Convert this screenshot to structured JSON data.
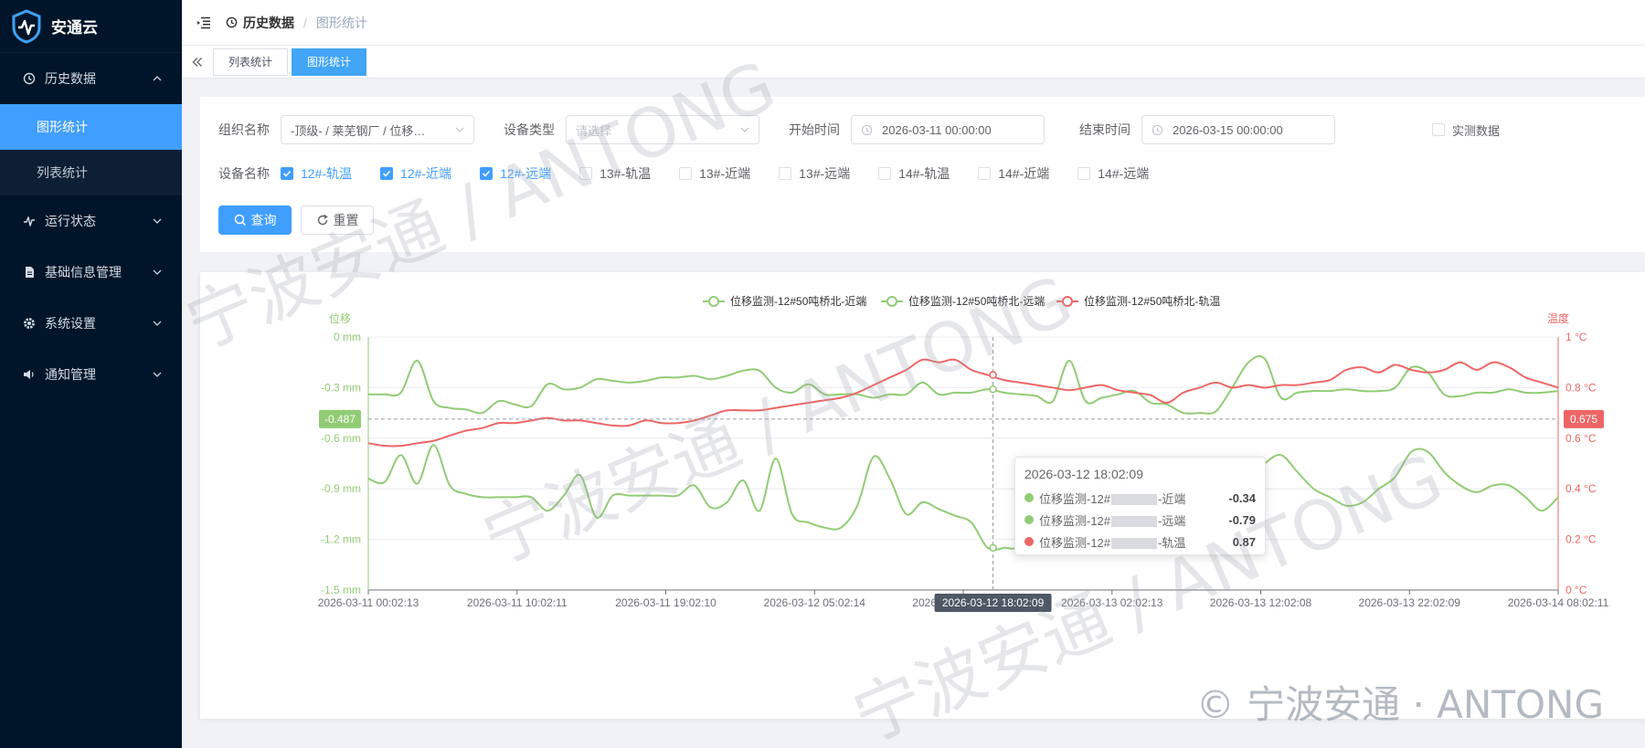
{
  "app": {
    "name": "安通云"
  },
  "sidebar": {
    "items": [
      {
        "label": "历史数据",
        "icon": "history-icon",
        "expanded": true,
        "children": [
          {
            "label": "图形统计",
            "active": true
          },
          {
            "label": "列表统计",
            "active": false
          }
        ]
      },
      {
        "label": "运行状态",
        "icon": "pulse-icon"
      },
      {
        "label": "基础信息管理",
        "icon": "document-icon"
      },
      {
        "label": "系统设置",
        "icon": "gear-icon"
      },
      {
        "label": "通知管理",
        "icon": "speaker-icon"
      }
    ]
  },
  "header": {
    "breadcrumb": [
      "历史数据",
      "图形统计"
    ],
    "separator": "/"
  },
  "tabs": [
    {
      "label": "列表统计",
      "active": false
    },
    {
      "label": "图形统计",
      "active": true
    }
  ],
  "filters": {
    "org_label": "组织名称",
    "org_value": "-顶级- / 莱芜钢厂 / 位移…",
    "type_label": "设备类型",
    "type_placeholder": "请选择",
    "start_label": "开始时间",
    "start_value": "2026-03-11 00:00:00",
    "end_label": "结束时间",
    "end_value": "2026-03-15 00:00:00",
    "realtime_label": "实测数据",
    "device_label": "设备名称",
    "devices": [
      {
        "label": "12#-轨温",
        "checked": true
      },
      {
        "label": "12#-近端",
        "checked": true
      },
      {
        "label": "12#-远端",
        "checked": true
      },
      {
        "label": "13#-轨温",
        "checked": false
      },
      {
        "label": "13#-近端",
        "checked": false
      },
      {
        "label": "13#-远端",
        "checked": false
      },
      {
        "label": "14#-轨温",
        "checked": false
      },
      {
        "label": "14#-近端",
        "checked": false
      },
      {
        "label": "14#-远端",
        "checked": false
      }
    ],
    "query_label": "查询",
    "reset_label": "重置"
  },
  "chart_data": {
    "type": "line",
    "legend_position": "top-center",
    "y_left": {
      "label": "位移",
      "unit": "mm",
      "min": -1.5,
      "max": 0,
      "ticks": [
        "0 mm",
        "-0.3 mm",
        "-0.6 mm",
        "-0.9 mm",
        "-1.2 mm",
        "-1.5 mm"
      ]
    },
    "y_right": {
      "label": "温度",
      "unit": "°C",
      "min": 0,
      "max": 1,
      "ticks": [
        "1 °C",
        "0.8 °C",
        "0.6 °C",
        "0.4 °C",
        "0.2 °C",
        "0 °C"
      ]
    },
    "x_ticks": [
      "2026-03-11 00:02:13",
      "2026-03-11 10:02:11",
      "2026-03-11 19:02:10",
      "2026-03-12 05:02:14",
      "2026-03-12 18:02:09",
      "2026-03-13 02:02:13",
      "2026-03-13 12:02:08",
      "2026-03-13 22:02:09",
      "2026-03-14 08:02:11"
    ],
    "x_span_hours": 80,
    "series": [
      {
        "name": "位移监测-12#50吨桥北-近端",
        "axis": "left",
        "color": "#91cc75",
        "values": [
          -0.34,
          -0.34,
          -0.33,
          -0.14,
          -0.38,
          -0.42,
          -0.43,
          -0.45,
          -0.38,
          -0.4,
          -0.41,
          -0.28,
          -0.31,
          -0.3,
          -0.25,
          -0.26,
          -0.27,
          -0.26,
          -0.24,
          -0.24,
          -0.23,
          -0.25,
          -0.23,
          -0.2,
          -0.2,
          -0.3,
          -0.33,
          -0.28,
          -0.34,
          -0.34,
          -0.34,
          -0.36,
          -0.34,
          -0.34,
          -0.27,
          -0.34,
          -0.33,
          -0.33,
          -0.31,
          -0.33,
          -0.34,
          -0.35,
          -0.38,
          -0.14,
          -0.38,
          -0.36,
          -0.34,
          -0.32,
          -0.39,
          -0.4,
          -0.45,
          -0.45,
          -0.44,
          -0.3,
          -0.15,
          -0.13,
          -0.36,
          -0.33,
          -0.32,
          -0.32,
          -0.31,
          -0.32,
          -0.32,
          -0.3,
          -0.18,
          -0.21,
          -0.34,
          -0.35,
          -0.33,
          -0.33,
          -0.31,
          -0.33,
          -0.33,
          -0.32
        ]
      },
      {
        "name": "位移监测-12#50吨桥北-远端",
        "axis": "left",
        "color": "#91cc75",
        "values": [
          -0.84,
          -0.86,
          -0.7,
          -0.87,
          -0.64,
          -0.88,
          -0.93,
          -0.95,
          -0.95,
          -0.95,
          -0.95,
          -1.03,
          -0.94,
          -0.82,
          -1.07,
          -0.94,
          -0.94,
          -0.94,
          -0.94,
          -0.94,
          -0.88,
          -1.01,
          -0.98,
          -0.85,
          -1.03,
          -0.72,
          -1.05,
          -1.1,
          -1.13,
          -1.13,
          -1.0,
          -0.71,
          -0.84,
          -1.05,
          -0.98,
          -1.02,
          -1.06,
          -1.1,
          -1.25,
          -1.25,
          -1.22,
          -0.9,
          -0.75,
          -0.75,
          -0.8,
          -0.8,
          -0.8,
          -0.78,
          -0.82,
          -0.86,
          -1.0,
          -1.1,
          -1.05,
          -0.95,
          -0.85,
          -0.75,
          -0.7,
          -0.8,
          -0.9,
          -0.95,
          -1.0,
          -0.98,
          -0.9,
          -0.83,
          -0.68,
          -0.68,
          -0.8,
          -0.88,
          -0.92,
          -0.88,
          -0.88,
          -0.95,
          -1.03,
          -0.95
        ]
      },
      {
        "name": "位移监测-12#50吨桥北-轨温",
        "axis": "right",
        "color": "#ee6666",
        "values": [
          0.58,
          0.57,
          0.57,
          0.58,
          0.59,
          0.61,
          0.63,
          0.64,
          0.66,
          0.66,
          0.67,
          0.68,
          0.67,
          0.67,
          0.66,
          0.65,
          0.65,
          0.67,
          0.66,
          0.66,
          0.67,
          0.69,
          0.71,
          0.71,
          0.71,
          0.72,
          0.73,
          0.74,
          0.75,
          0.76,
          0.78,
          0.81,
          0.84,
          0.87,
          0.91,
          0.9,
          0.91,
          0.87,
          0.85,
          0.83,
          0.82,
          0.81,
          0.8,
          0.79,
          0.8,
          0.81,
          0.79,
          0.78,
          0.77,
          0.74,
          0.78,
          0.8,
          0.82,
          0.8,
          0.81,
          0.8,
          0.81,
          0.81,
          0.82,
          0.83,
          0.87,
          0.88,
          0.86,
          0.89,
          0.87,
          0.86,
          0.87,
          0.9,
          0.87,
          0.9,
          0.88,
          0.84,
          0.82,
          0.8
        ]
      }
    ],
    "crosshair": {
      "time": "2026-03-12 18:02:09",
      "x_hours": 42.0,
      "left_value": "-0.487",
      "right_value": "0.675"
    },
    "tooltip": {
      "title": "2026-03-12 18:02:09",
      "rows": [
        {
          "name": "位移监测-12#50吨桥北-近端",
          "shown": "位移监测-12#",
          "suffix": "-近端",
          "value": "-0.34",
          "color": "#91cc75"
        },
        {
          "name": "位移监测-12#50吨桥北-远端",
          "shown": "位移监测-12#",
          "suffix": "-远端",
          "value": "-0.79",
          "color": "#91cc75"
        },
        {
          "name": "位移监测-12#50吨桥北-轨温",
          "shown": "位移监测-12#",
          "suffix": "-轨温",
          "value": "0.87",
          "color": "#ee6666"
        }
      ]
    }
  },
  "watermark": {
    "text": "宁波安通 / ANTONG",
    "copyright": "© 宁波安通 · ANTONG"
  }
}
